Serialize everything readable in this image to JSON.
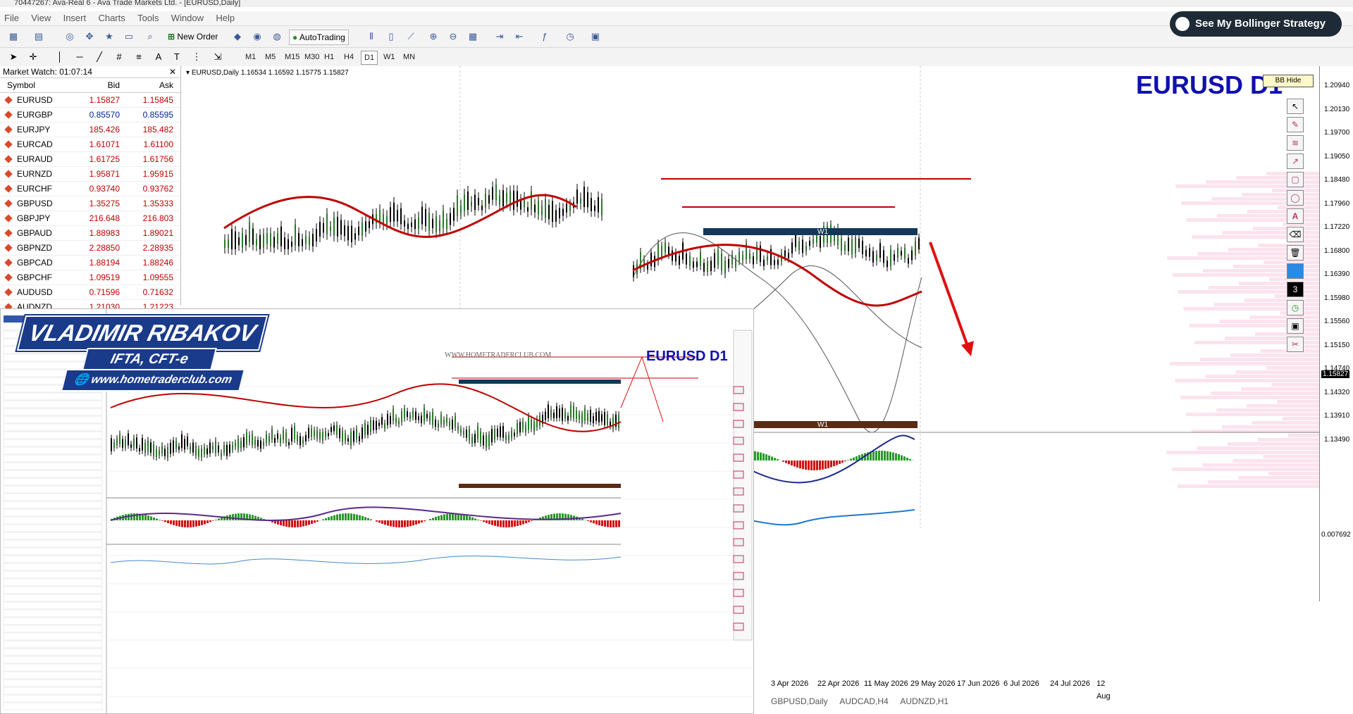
{
  "window": {
    "title": "70447267: Ava-Real 6 - Ava Trade Markets Ltd. - [EURUSD,Daily]"
  },
  "menu": [
    "File",
    "View",
    "Insert",
    "Charts",
    "Tools",
    "Window",
    "Help"
  ],
  "toolbar": {
    "new_order": "New Order",
    "autotrading": "AutoTrading"
  },
  "timeframes": [
    "M1",
    "M5",
    "M15",
    "M30",
    "H1",
    "H4",
    "D1",
    "W1",
    "MN"
  ],
  "market_watch": {
    "title": "Market Watch: 01:07:14",
    "headers": {
      "symbol": "Symbol",
      "bid": "Bid",
      "ask": "Ask"
    },
    "rows": [
      {
        "symbol": "EURUSD",
        "bid": "1.15827",
        "ask": "1.15845"
      },
      {
        "symbol": "EURGBP",
        "bid": "0.85570",
        "ask": "0.85595"
      },
      {
        "symbol": "EURJPY",
        "bid": "185.426",
        "ask": "185.482"
      },
      {
        "symbol": "EURCAD",
        "bid": "1.61071",
        "ask": "1.61100"
      },
      {
        "symbol": "EURAUD",
        "bid": "1.61725",
        "ask": "1.61756"
      },
      {
        "symbol": "EURNZD",
        "bid": "1.95871",
        "ask": "1.95915"
      },
      {
        "symbol": "EURCHF",
        "bid": "0.93740",
        "ask": "0.93762"
      },
      {
        "symbol": "GBPUSD",
        "bid": "1.35275",
        "ask": "1.35333"
      },
      {
        "symbol": "GBPJPY",
        "bid": "216.648",
        "ask": "216.803"
      },
      {
        "symbol": "GBPAUD",
        "bid": "1.88983",
        "ask": "1.89021"
      },
      {
        "symbol": "GBPNZD",
        "bid": "2.28850",
        "ask": "2.28935"
      },
      {
        "symbol": "GBPCAD",
        "bid": "1.88194",
        "ask": "1.88246"
      },
      {
        "symbol": "GBPCHF",
        "bid": "1.09519",
        "ask": "1.09555"
      },
      {
        "symbol": "AUDUSD",
        "bid": "0.71596",
        "ask": "0.71632"
      },
      {
        "symbol": "AUDNZD",
        "bid": "1.21030",
        "ask": "1.21223"
      }
    ]
  },
  "chart": {
    "header": "EURUSD,Daily  1.16534 1.16592 1.15775 1.15827",
    "symbol_label": "EURUSD  D1",
    "bb_hide": "BB Hide",
    "zone_label_top": "W1",
    "zone_label_bottom": "W1",
    "price_labels": [
      "1.20940",
      "1.20130",
      "1.19700",
      "1.19050",
      "1.18480",
      "1.17960",
      "1.17220",
      "1.16800",
      "1.16390",
      "1.15980",
      "1.15560",
      "1.15150",
      "1.14740",
      "1.14320",
      "1.13910",
      "1.13490"
    ],
    "current_price": "1.15827",
    "macd_value": "0.007692",
    "dates": [
      "3 Apr 2026",
      "22 Apr 2026",
      "11 May 2026",
      "29 May 2026",
      "17 Jun 2026",
      "6 Jul 2026",
      "24 Jul 2026",
      "12 Aug"
    ],
    "colors": {
      "ma": "#c00000",
      "zone": "#15375a",
      "zone_bottom": "#5a2c14",
      "arrow": "#e01010",
      "label": "#1010b0"
    }
  },
  "promo": {
    "text": "See My Bollinger Strategy"
  },
  "presenter": {
    "name": "VLADIMIR RIBAKOV",
    "cert": "IFTA, CFT-e",
    "site": "www.hometraderclub.com"
  },
  "inset": {
    "watermark": "WWW.HOMETRADERCLUB.COM",
    "symbol_label": "EURUSD  D1"
  },
  "bottom_tabs": [
    "GBPUSD,Daily",
    "AUDCAD,H4",
    "AUDNZD,H1"
  ]
}
